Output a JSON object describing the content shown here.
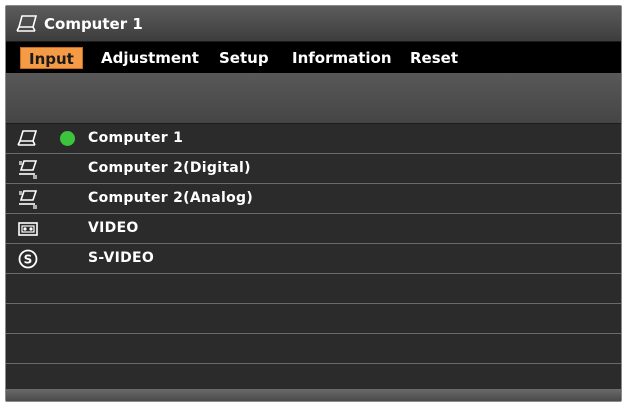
{
  "title": "Computer 1",
  "menu": {
    "tabs": [
      {
        "label": "Input",
        "active": true
      },
      {
        "label": "Adjustment",
        "active": false
      },
      {
        "label": "Setup",
        "active": false
      },
      {
        "label": "Information",
        "active": false
      },
      {
        "label": "Reset",
        "active": false
      }
    ]
  },
  "inputs": [
    {
      "label": "Computer 1",
      "icon": "computer1-icon",
      "selected": true
    },
    {
      "label": "Computer 2(Digital)",
      "icon": "computer2-digital-icon",
      "selected": false
    },
    {
      "label": "Computer 2(Analog)",
      "icon": "computer2-analog-icon",
      "selected": false
    },
    {
      "label": "VIDEO",
      "icon": "video-icon",
      "selected": false
    },
    {
      "label": "S-VIDEO",
      "icon": "s-video-icon",
      "selected": false
    }
  ],
  "colors": {
    "active_tab": "#f59a45",
    "selected_dot": "#3cc43c"
  }
}
